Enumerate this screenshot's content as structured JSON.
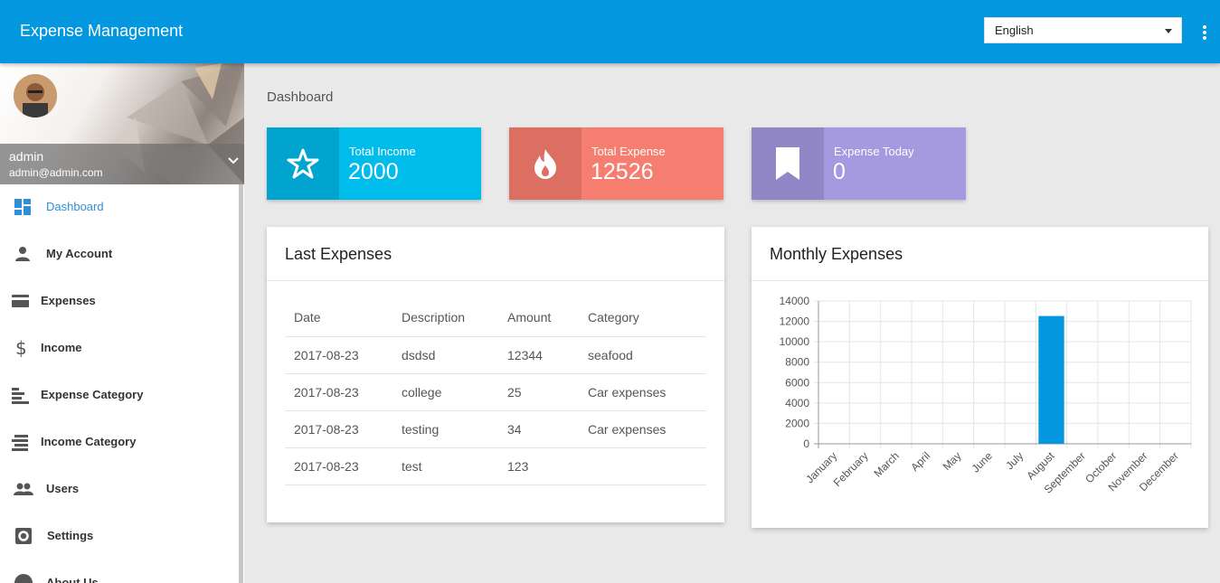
{
  "header": {
    "title": "Expense Management",
    "language": "English",
    "more_icon": "more-vert-icon"
  },
  "sidebar": {
    "user": {
      "name": "admin",
      "email": "admin@admin.com"
    },
    "items": [
      {
        "label": "Dashboard",
        "icon": "dashboard-icon",
        "active": true
      },
      {
        "label": "My Account",
        "icon": "person-icon"
      },
      {
        "label": "Expenses",
        "icon": "credit-card-icon"
      },
      {
        "label": "Income",
        "icon": "dollar-icon"
      },
      {
        "label": "Expense Category",
        "icon": "sort-icon"
      },
      {
        "label": "Income Category",
        "icon": "stack-icon"
      },
      {
        "label": "Users",
        "icon": "people-icon"
      },
      {
        "label": "Settings",
        "icon": "settings-icon"
      },
      {
        "label": "About Us",
        "icon": "info-icon"
      }
    ]
  },
  "breadcrumb": "Dashboard",
  "stats": [
    {
      "label": "Total Income",
      "value": "2000",
      "icon": "star-icon",
      "color": "#00bcea",
      "icon_bg": "#00a4cf"
    },
    {
      "label": "Total Expense",
      "value": "12526",
      "icon": "fire-icon",
      "color": "#f67e70",
      "icon_bg": "#dc6f62"
    },
    {
      "label": "Expense Today",
      "value": "0",
      "icon": "bookmark-icon",
      "color": "#a599e0",
      "icon_bg": "#9186c6"
    }
  ],
  "last_expenses": {
    "title": "Last Expenses",
    "columns": [
      "Date",
      "Description",
      "Amount",
      "Category"
    ],
    "rows": [
      [
        "2017-08-23",
        "dsdsd",
        "12344",
        "seafood"
      ],
      [
        "2017-08-23",
        "college",
        "25",
        "Car expenses"
      ],
      [
        "2017-08-23",
        "testing",
        "34",
        "Car expenses"
      ],
      [
        "2017-08-23",
        "test",
        "123",
        ""
      ]
    ]
  },
  "monthly": {
    "title": "Monthly Expenses"
  },
  "chart_data": {
    "type": "bar",
    "categories": [
      "January",
      "February",
      "March",
      "April",
      "May",
      "June",
      "July",
      "August",
      "September",
      "October",
      "November",
      "December"
    ],
    "values": [
      0,
      0,
      0,
      0,
      0,
      0,
      0,
      12526,
      0,
      0,
      0,
      0
    ],
    "ylim": [
      0,
      14000
    ],
    "yticks": [
      0,
      2000,
      4000,
      6000,
      8000,
      10000,
      12000,
      14000
    ],
    "grid": true,
    "bar_color": "#0397e0"
  }
}
